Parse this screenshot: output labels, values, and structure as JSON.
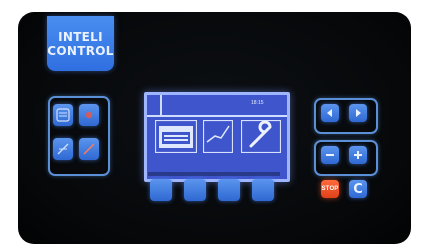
{
  "logo": {
    "line1": "INTELI",
    "line2": "CONTROL"
  },
  "screen": {
    "time": "18:15",
    "menu": [
      {
        "icon": "oven-icon",
        "selected": true
      },
      {
        "icon": "chart-icon",
        "selected": false
      },
      {
        "icon": "wrench-icon",
        "selected": false
      }
    ]
  },
  "buttons": {
    "left_top": [
      "heat-icon",
      "fan-icon"
    ],
    "left_bottom": [
      "probe-icon",
      "moisture-off-icon"
    ],
    "nav": [
      "arrow-left-icon",
      "arrow-right-icon"
    ],
    "adjust": [
      "minus-icon",
      "plus-icon"
    ],
    "stop_label": "STOP",
    "clear_label": "C"
  },
  "colors": {
    "panel_bg": "#06080a",
    "button_blue": "#3a78e0",
    "screen_bg": "#3f55cc",
    "stop_red": "#f04d22"
  }
}
